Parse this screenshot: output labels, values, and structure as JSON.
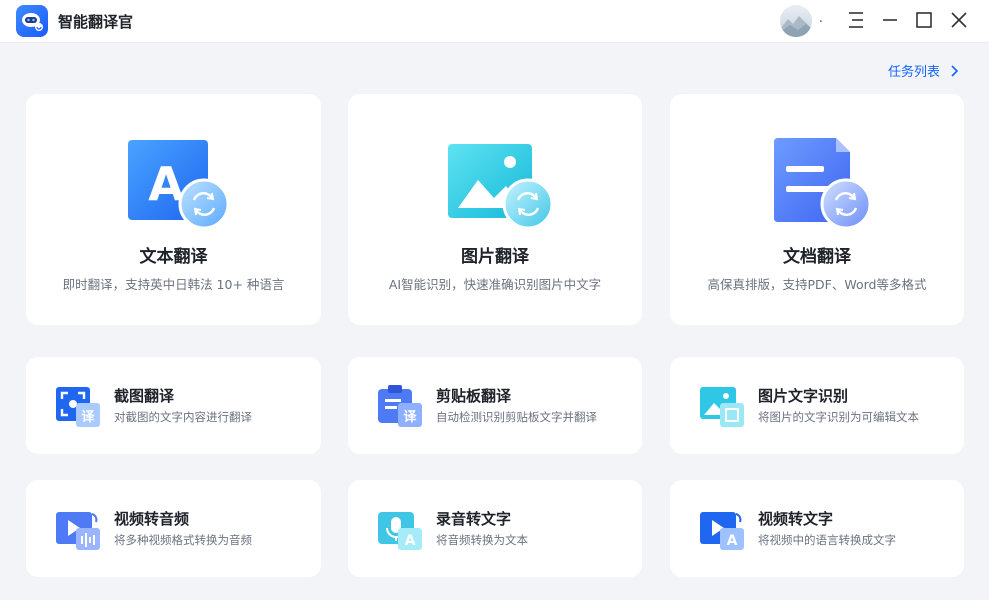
{
  "titlebar": {
    "app_title": "智能翻译官",
    "avatar_suffix": "."
  },
  "task_list": {
    "label": "任务列表"
  },
  "big_cards": [
    {
      "title": "文本翻译",
      "desc": "即时翻译，支持英中日韩法 10+ 种语言",
      "icon": "text-translate-icon",
      "glyph": "A"
    },
    {
      "title": "图片翻译",
      "desc": "AI智能识别，快速准确识别图片中文字",
      "icon": "image-translate-icon"
    },
    {
      "title": "文档翻译",
      "desc": "高保真排版，支持PDF、Word等多格式",
      "icon": "document-translate-icon"
    }
  ],
  "small_cards": [
    {
      "title": "截图翻译",
      "desc": "对截图的文字内容进行翻译",
      "icon": "screenshot-translate-icon",
      "badge": "译"
    },
    {
      "title": "剪贴板翻译",
      "desc": "自动检测识别剪贴板文字并翻译",
      "icon": "clipboard-translate-icon",
      "badge": "译"
    },
    {
      "title": "图片文字识别",
      "desc": "将图片的文字识别为可编辑文本",
      "icon": "image-ocr-icon"
    },
    {
      "title": "视频转音频",
      "desc": "将多种视频格式转换为音频",
      "icon": "video-to-audio-icon"
    },
    {
      "title": "录音转文字",
      "desc": "将音频转换为文本",
      "icon": "audio-to-text-icon",
      "badge": "A"
    },
    {
      "title": "视频转文字",
      "desc": "将视频中的语言转换成文字",
      "icon": "video-to-text-icon",
      "badge": "A"
    }
  ],
  "colors": {
    "accent": "#1664ff",
    "background": "#f3f4f7",
    "card": "#ffffff"
  }
}
